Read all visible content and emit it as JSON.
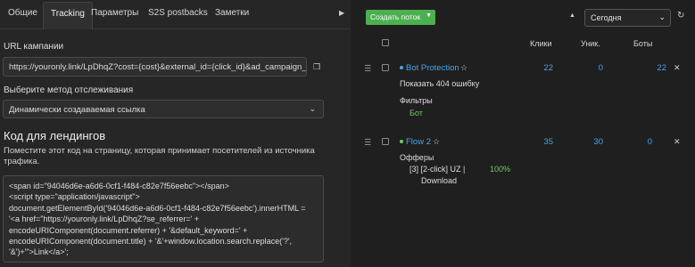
{
  "tabs": [
    "Общие",
    "Tracking",
    "Параметры",
    "S2S postbacks",
    "Заметки"
  ],
  "tabs_scroll_icon": "triangle-right-icon",
  "campaign_url": {
    "label": "URL кампании",
    "value": "https://youronly.link/LpDhqZ?cost={cost}&external_id={click_id}&ad_campaign_id={ad_campaign_id}"
  },
  "tracking_method": {
    "label": "Выберите метод отслеживания",
    "value": "Динамически создаваемая ссылка"
  },
  "landing_code": {
    "heading": "Код для лендингов",
    "description": "Поместите этот код на страницу, которая принимает посетителей из источника трафика.",
    "code": "<span id=\"94046d6e-a6d6-0cf1-f484-c82e7f56eebc\"></span>\n<script type=\"application/javascript\">\ndocument.getElementById('94046d6e-a6d6-0cf1-f484-c82e7f56eebc').innerHTML =\n'<a href=\"https://youronly.link/LpDhqZ?se_referrer=' +\nencodeURIComponent(document.referrer) + '&default_keyword=' +\nencodeURIComponent(document.title) + '&'+window.location.search.replace('?',\n'&')+'\">Link</a>';"
  },
  "toolbar": {
    "create_flow": "Создать поток",
    "period": "Сегодня"
  },
  "columns": [
    "Клики",
    "Уник.",
    "Боты"
  ],
  "flows": [
    {
      "name": "Bot Protection",
      "status_color": "#4aa3e8",
      "clicks": "22",
      "unique": "0",
      "bots": "22",
      "detail": "Показать 404 ошибку",
      "section_label": "Фильтры",
      "section_value": "Бот"
    },
    {
      "name": "Flow 2",
      "status_color": "#6ccf5a",
      "clicks": "35",
      "unique": "30",
      "bots": "0",
      "section_label": "Офферы",
      "offer_line1": "[3] [2-click] UZ |",
      "offer_line2": "Download",
      "offer_share": "100%"
    }
  ]
}
